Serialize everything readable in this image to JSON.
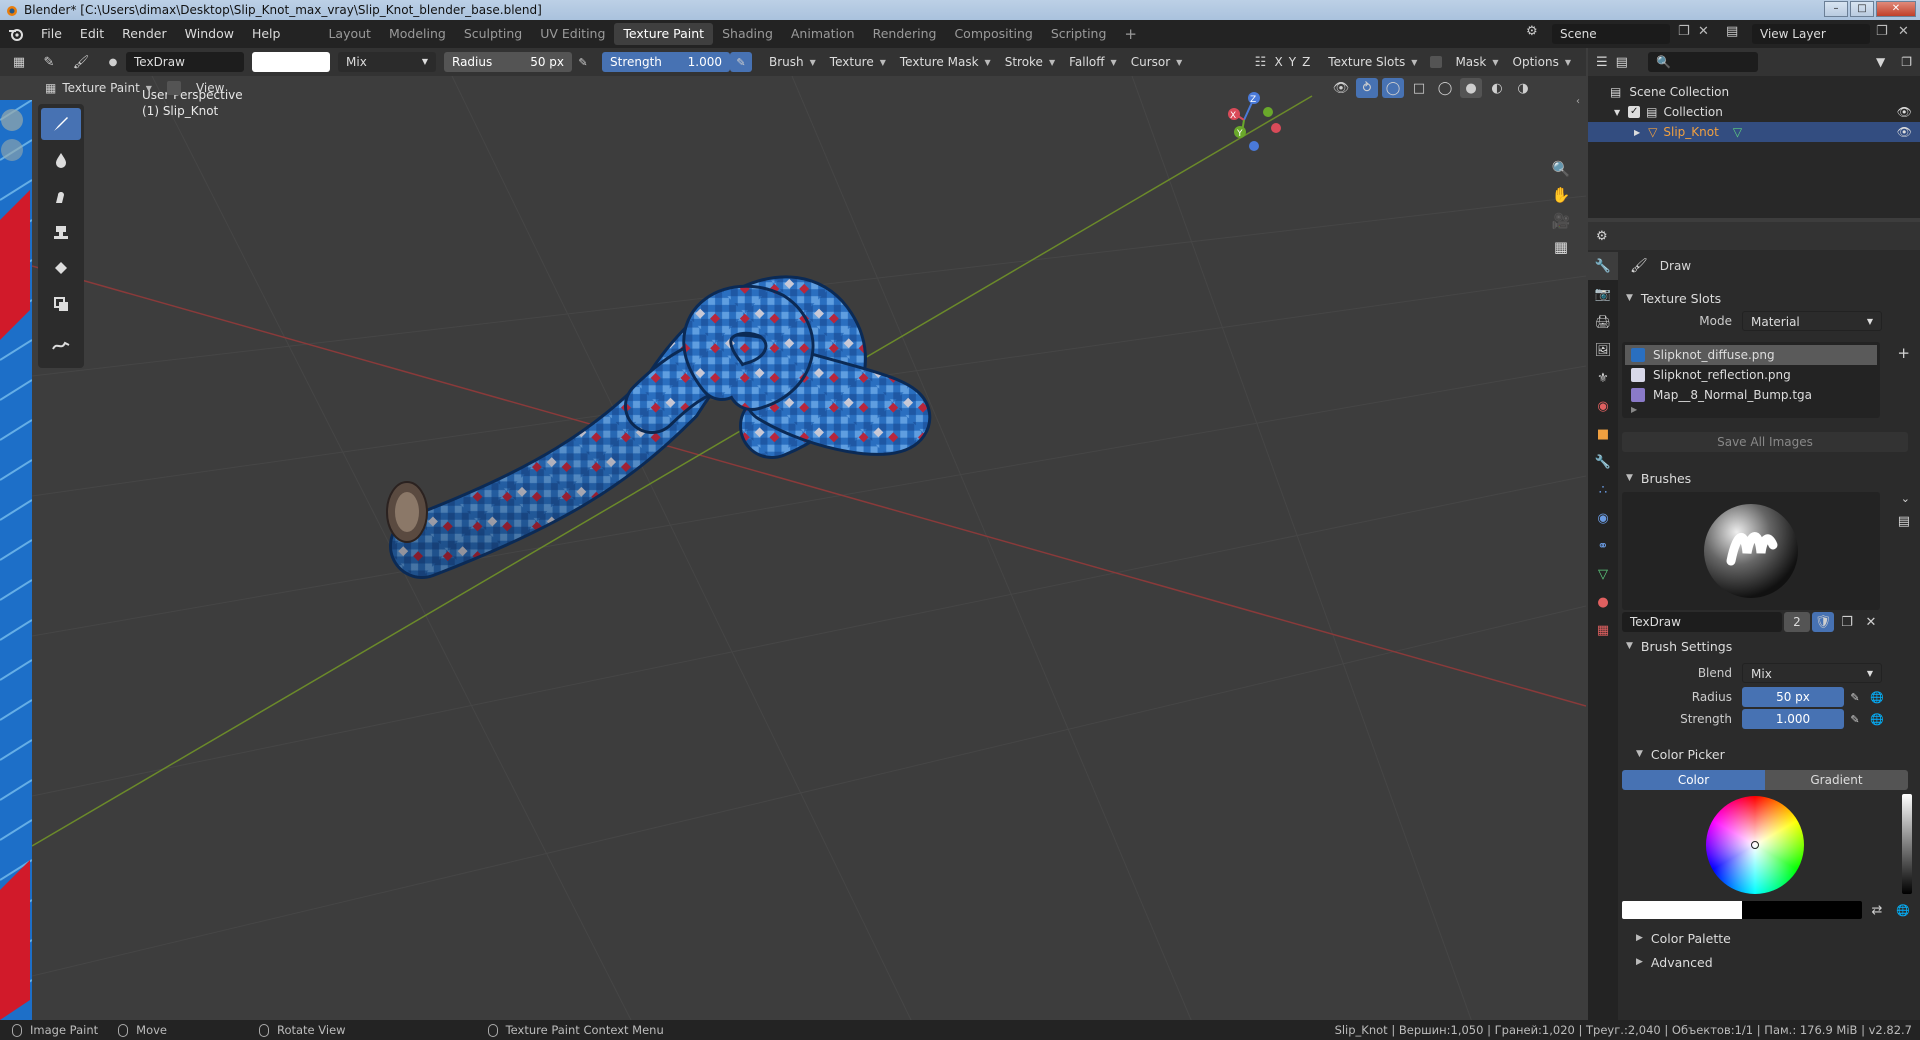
{
  "window": {
    "title": "Blender* [C:\\Users\\dimax\\Desktop\\Slip_Knot_max_vray\\Slip_Knot_blender_base.blend]"
  },
  "menu": [
    "File",
    "Edit",
    "Render",
    "Window",
    "Help"
  ],
  "workspaces": [
    "Layout",
    "Modeling",
    "Sculpting",
    "UV Editing",
    "Texture Paint",
    "Shading",
    "Animation",
    "Rendering",
    "Compositing",
    "Scripting"
  ],
  "active_workspace": "Texture Paint",
  "scene": {
    "label": "Scene",
    "view_layer": "View Layer"
  },
  "tool_header": {
    "brush_name": "TexDraw",
    "blend": "Mix",
    "radius_label": "Radius",
    "radius_value": "50 px",
    "strength_label": "Strength",
    "strength_value": "1.000",
    "menus": [
      "Brush",
      "Texture",
      "Texture Mask",
      "Stroke",
      "Falloff",
      "Cursor"
    ],
    "axis": [
      "X",
      "Y",
      "Z"
    ],
    "texture_slots": "Texture Slots",
    "mask": "Mask",
    "options": "Options"
  },
  "viewport_header": {
    "mode": "Texture Paint",
    "view": "View"
  },
  "viewport": {
    "perspective": "User Perspective",
    "object": "(1) Slip_Knot"
  },
  "gizmo": {
    "x": "X",
    "y": "Y",
    "z": "Z"
  },
  "outliner": {
    "root": "Scene Collection",
    "collection": "Collection",
    "object": "Slip_Knot"
  },
  "properties": {
    "tool_name": "Draw",
    "texture_slots_title": "Texture Slots",
    "mode_label": "Mode",
    "mode_value": "Material",
    "slots": [
      "Slipknot_diffuse.png",
      "Slipknot_reflection.png",
      "Map__8_Normal_Bump.tga"
    ],
    "save_all": "Save All Images",
    "brushes_title": "Brushes",
    "brush_name": "TexDraw",
    "brush_users": "2",
    "brush_settings_title": "Brush Settings",
    "blend_label": "Blend",
    "blend_value": "Mix",
    "radius_label": "Radius",
    "radius_value": "50 px",
    "strength_label": "Strength",
    "strength_value": "1.000",
    "color_picker_title": "Color Picker",
    "color_tab": "Color",
    "gradient_tab": "Gradient",
    "color_palette": "Color Palette",
    "advanced": "Advanced"
  },
  "status": {
    "image_paint": "Image Paint",
    "move": "Move",
    "rotate": "Rotate View",
    "context": "Texture Paint Context Menu",
    "stats": "Slip_Knot | Вершин:1,050 | Граней:1,020 | Треуг.:2,040 | Объектов:1/1 | Пам.: 176.9 MiB | v2.82.7"
  },
  "colors": {
    "accent": "#4772b3",
    "rope_blue": "#2a6fc0",
    "rope_red": "#b8263c"
  }
}
